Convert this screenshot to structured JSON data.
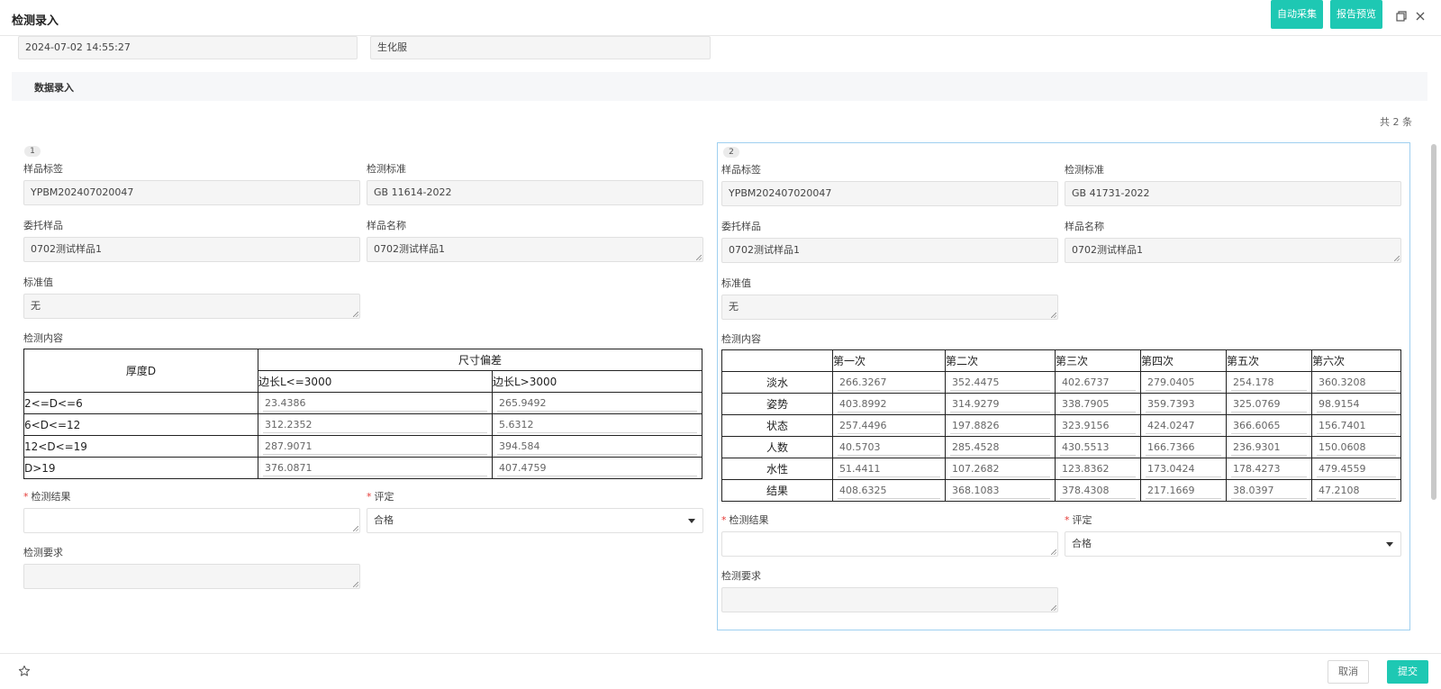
{
  "header": {
    "title": "检测录入",
    "auto_collect": "自动采集",
    "report_preview": "报告预览",
    "restore_icon": "restore-icon",
    "close_icon": "close-icon"
  },
  "top_fields": {
    "datetime": "2024-07-02 14:55:27",
    "category": "生化服"
  },
  "section": {
    "title": "数据录入",
    "total": "共 2 条"
  },
  "cards": [
    {
      "index": "1",
      "sample_tag_label": "样品标签",
      "sample_tag": "YPBM202407020047",
      "standard_label": "检测标准",
      "standard": "GB 11614-2022",
      "entrusted_label": "委托样品",
      "entrusted": "0702测试样品1",
      "sample_name_label": "样品名称",
      "sample_name": "0702测试样品1",
      "std_value_label": "标准值",
      "std_value": "无",
      "content_label": "检测内容",
      "table": {
        "corner": "厚度D",
        "group_header": "尺寸偏差",
        "col_headers": [
          "边长L<=3000",
          "边长L>3000"
        ],
        "rows": [
          {
            "label": "2<=D<=6",
            "values": [
              "23.4386",
              "265.9492"
            ]
          },
          {
            "label": "6<D<=12",
            "values": [
              "312.2352",
              "5.6312"
            ]
          },
          {
            "label": "12<D<=19",
            "values": [
              "287.9071",
              "394.584"
            ]
          },
          {
            "label": "D>19",
            "values": [
              "376.0871",
              "407.4759"
            ]
          }
        ]
      },
      "result_label": "检测结果",
      "result": "",
      "rating_label": "评定",
      "rating": "合格",
      "requirement_label": "检测要求",
      "requirement": ""
    },
    {
      "index": "2",
      "sample_tag_label": "样品标签",
      "sample_tag": "YPBM202407020047",
      "standard_label": "检测标准",
      "standard": "GB 41731-2022",
      "entrusted_label": "委托样品",
      "entrusted": "0702测试样品1",
      "sample_name_label": "样品名称",
      "sample_name": "0702测试样品1",
      "std_value_label": "标准值",
      "std_value": "无",
      "content_label": "检测内容",
      "table": {
        "corner": "",
        "col_headers": [
          "第一次",
          "第二次",
          "第三次",
          "第四次",
          "第五次",
          "第六次"
        ],
        "rows": [
          {
            "label": "淡水",
            "values": [
              "266.3267",
              "352.4475",
              "402.6737",
              "279.0405",
              "254.178",
              "360.3208"
            ]
          },
          {
            "label": "姿势",
            "values": [
              "403.8992",
              "314.9279",
              "338.7905",
              "359.7393",
              "325.0769",
              "98.9154"
            ]
          },
          {
            "label": "状态",
            "values": [
              "257.4496",
              "197.8826",
              "323.9156",
              "424.0247",
              "366.6065",
              "156.7401"
            ]
          },
          {
            "label": "人数",
            "values": [
              "40.5703",
              "285.4528",
              "430.5513",
              "166.7366",
              "236.9301",
              "150.0608"
            ]
          },
          {
            "label": "水性",
            "values": [
              "51.4411",
              "107.2682",
              "123.8362",
              "173.0424",
              "178.4273",
              "479.4559"
            ]
          },
          {
            "label": "结果",
            "values": [
              "408.6325",
              "368.1083",
              "378.4308",
              "217.1669",
              "38.0397",
              "47.2108"
            ]
          }
        ]
      },
      "result_label": "检测结果",
      "result": "",
      "rating_label": "评定",
      "rating": "合格",
      "requirement_label": "检测要求",
      "requirement": ""
    }
  ],
  "footer": {
    "star_icon": "star-icon",
    "cancel": "取消",
    "submit": "提交"
  },
  "colors": {
    "accent": "#1ec8b3",
    "selected_border": "#9fd0f0",
    "required": "#e53935"
  }
}
